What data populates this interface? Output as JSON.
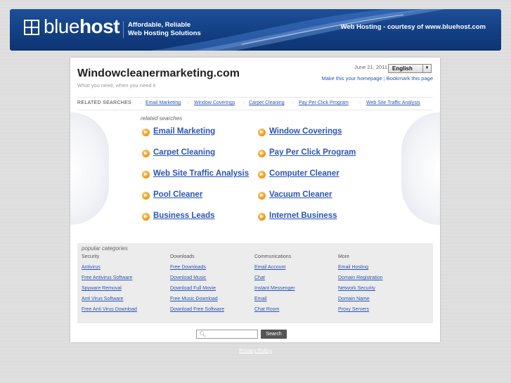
{
  "header": {
    "logo_prefix": "blue",
    "logo_bold": "host",
    "tagline_1": "Affordable, Reliable",
    "tagline_2": "Web Hosting Solutions",
    "courtesy": "Web Hosting - courtesy of www.bluehost.com"
  },
  "site": {
    "domain": "Windowcleanermarketing.com",
    "subtitle": "What you need, when you need it",
    "date": "June 21, 2011",
    "language": "English",
    "make_homepage": "Make this your homepage",
    "bookmark": "Bookmark this page"
  },
  "related_bar": {
    "title": "RELATED SEARCHES",
    "links": [
      "Email Marketing",
      "Window Coverings",
      "Carpet Cleaning",
      "Pay Per Click Program",
      "Web Site Traffic Analysis"
    ]
  },
  "related_searches": {
    "title": "related searches",
    "items": [
      "Email Marketing",
      "Window Coverings",
      "Carpet Cleaning",
      "Pay Per Click Program",
      "Web Site Traffic Analysis",
      "Computer Cleaner",
      "Pool Cleaner",
      "Vacuum Cleaner",
      "Business Leads",
      "Internet Business"
    ]
  },
  "popular": {
    "title": "popular categories",
    "columns": [
      {
        "head": "Security",
        "links": [
          "Antivirus",
          "Free Antivirus Software",
          "Spyware Removal",
          "Anti Virus Software",
          "Free Anti Virus Download"
        ]
      },
      {
        "head": "Downloads",
        "links": [
          "Free Downloads",
          "Download Music",
          "Download Full Movie",
          "Free Music Download",
          "Download Free Software"
        ]
      },
      {
        "head": "Communications",
        "links": [
          "Email Account",
          "Chat",
          "Instant Messenger",
          "Email",
          "Chat Room"
        ]
      },
      {
        "head": "More",
        "links": [
          "Email Hosting",
          "Domain Registration",
          "Network Security",
          "Domain Name",
          "Proxy Servers"
        ]
      }
    ]
  },
  "search": {
    "button": "Search",
    "icon": "magnifier-icon"
  },
  "footer": {
    "privacy": "Privacy Policy"
  },
  "colors": {
    "link": "#2a55b5",
    "banner": "#123e82",
    "bullet": "#f09312"
  }
}
